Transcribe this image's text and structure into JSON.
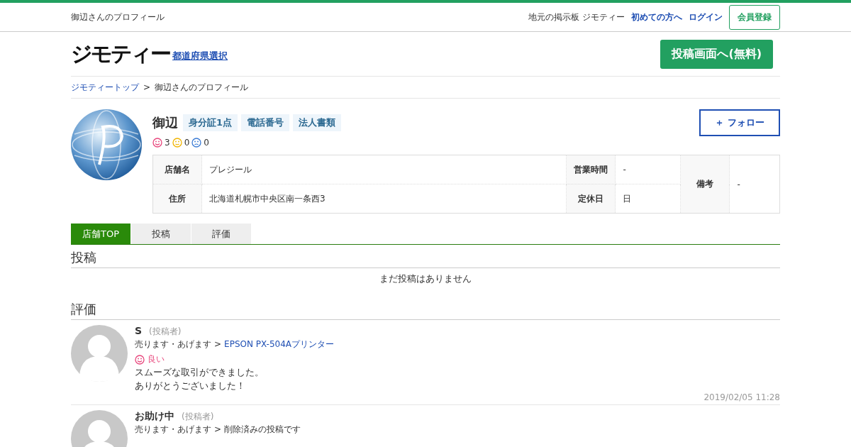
{
  "header": {
    "page_title": "御辺さんのプロフィール",
    "site_label": "地元の掲示板 ジモティー",
    "links": [
      "初めての方へ",
      "ログイン"
    ],
    "register_button": "会員登録"
  },
  "brand": {
    "logo": "ジモティー",
    "region_link": "都道府県選択",
    "post_button": "投稿画面へ(無料)"
  },
  "breadcrumb": {
    "items": [
      {
        "label": "ジモティートップ",
        "link": true
      },
      {
        "label": "御辺さんのプロフィール",
        "link": false
      }
    ],
    "separator": ">"
  },
  "profile": {
    "name": "御辺",
    "badges": [
      "身分証1点",
      "電話番号",
      "法人書類"
    ],
    "follow_button": "＋ フォロー",
    "ratings": [
      {
        "kind": "good",
        "count": "3"
      },
      {
        "kind": "normal",
        "count": "0"
      },
      {
        "kind": "bad",
        "count": "0"
      }
    ],
    "info": {
      "rows": [
        [
          {
            "label": "店舗名",
            "value": "プレジール"
          },
          {
            "label": "営業時間",
            "value": "-"
          }
        ],
        [
          {
            "label": "住所",
            "value": "北海道札幌市中央区南一条西3"
          },
          {
            "label": "定休日",
            "value": "日"
          }
        ]
      ],
      "note": {
        "label": "備考",
        "value": "-"
      }
    }
  },
  "tabs": [
    {
      "label": "店舗TOP",
      "selected": true
    },
    {
      "label": "投稿",
      "selected": false
    },
    {
      "label": "評価",
      "selected": false
    }
  ],
  "posts": {
    "heading": "投稿",
    "empty_message": "まだ投稿はありません"
  },
  "reviews": {
    "heading": "評価",
    "separator": ">",
    "items": [
      {
        "name": "S",
        "role": "(投稿者)",
        "category": "売ります・あげます",
        "item": "EPSON PX-504Aプリンター",
        "item_link": true,
        "rating": {
          "kind": "good",
          "label": "良い"
        },
        "comment": [
          "スムーズな取引ができました。",
          "ありがとうございました！"
        ],
        "date": "2019/02/05 11:28"
      },
      {
        "name": "お助け中",
        "role": "(投稿者)",
        "category": "売ります・あげます",
        "item": "削除済みの投稿です",
        "item_link": false
      }
    ]
  }
}
